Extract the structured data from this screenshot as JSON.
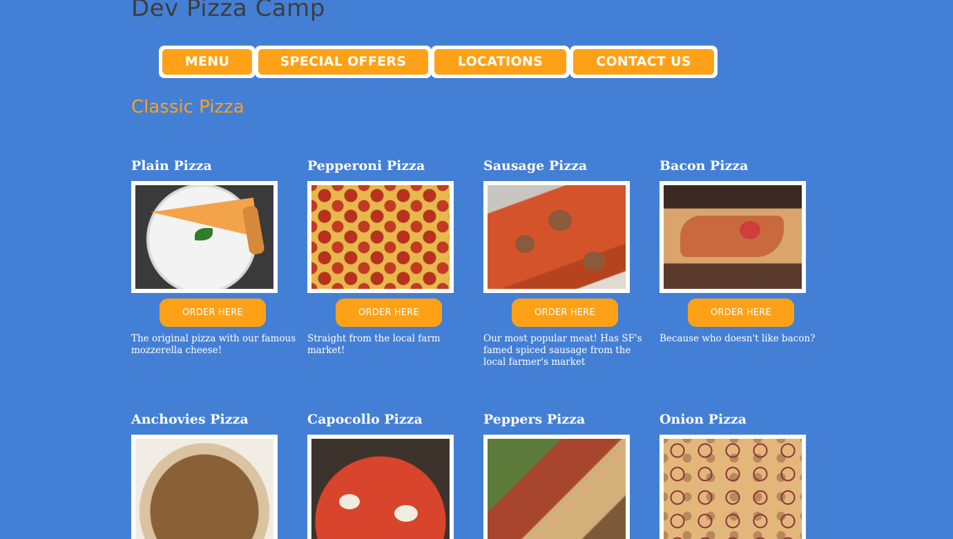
{
  "site": {
    "title": "Dev Pizza Camp"
  },
  "nav": {
    "items": [
      {
        "label": "MENU"
      },
      {
        "label": "SPECIAL OFFERS"
      },
      {
        "label": "LOCATIONS"
      },
      {
        "label": "CONTACT US"
      }
    ]
  },
  "section": {
    "title": "Classic Pizza"
  },
  "pizzas": [
    {
      "name": "Plain Pizza",
      "button": "ORDER HERE",
      "description": "The original pizza with our famous mozzerella cheese!"
    },
    {
      "name": "Pepperoni Pizza",
      "button": "ORDER HERE",
      "description": "Straight from the local farm market!"
    },
    {
      "name": "Sausage Pizza",
      "button": "ORDER HERE",
      "description": "Our most popular meat! Has SF's famed spiced sausage from the local farmer's market"
    },
    {
      "name": "Bacon Pizza",
      "button": "ORDER HERE",
      "description": "Because who doesn't like bacon?"
    },
    {
      "name": "Anchovies Pizza"
    },
    {
      "name": "Capocollo Pizza"
    },
    {
      "name": "Peppers Pizza"
    },
    {
      "name": "Onion Pizza"
    }
  ],
  "colors": {
    "background": "#447fd6",
    "accent": "#ffa116",
    "title_text": "#3d3d3d",
    "light_text": "#ffffff"
  }
}
